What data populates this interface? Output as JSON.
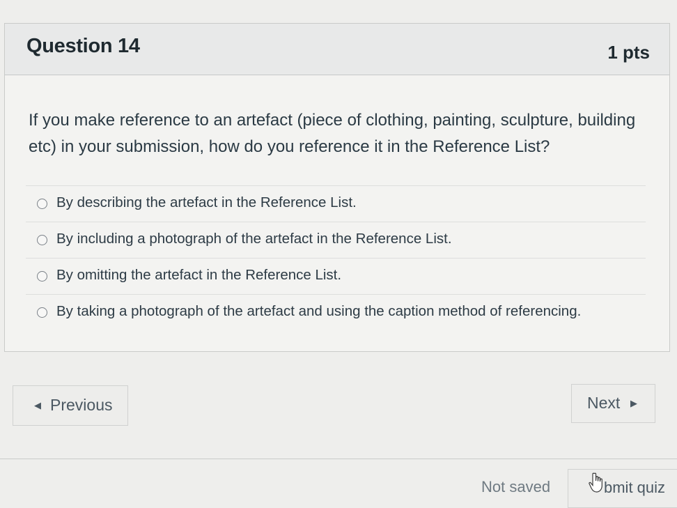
{
  "question": {
    "title": "Question 14",
    "points": "1 pts",
    "text": "If you make reference to an artefact (piece of clothing, painting, sculpture, building etc) in your submission, how do you reference it in the Reference List?",
    "answers": [
      {
        "label": "By describing the artefact in the Reference List.",
        "selected": false
      },
      {
        "label": "By including a photograph of the artefact in the Reference List.",
        "selected": false
      },
      {
        "label": "By omitting the artefact in the Reference List.",
        "selected": false
      },
      {
        "label": "By taking a photograph of the artefact and using the caption method of referencing.",
        "selected": false
      }
    ]
  },
  "navigation": {
    "previous_label": "Previous",
    "previous_icon": "caret-left-icon",
    "next_label": "Next",
    "next_icon": "caret-right-icon"
  },
  "footer": {
    "status": "Not saved",
    "submit_label": "Submit quiz",
    "submit_label_visible": "bmit quiz",
    "cursor_icon": "hand-pointer-icon"
  }
}
